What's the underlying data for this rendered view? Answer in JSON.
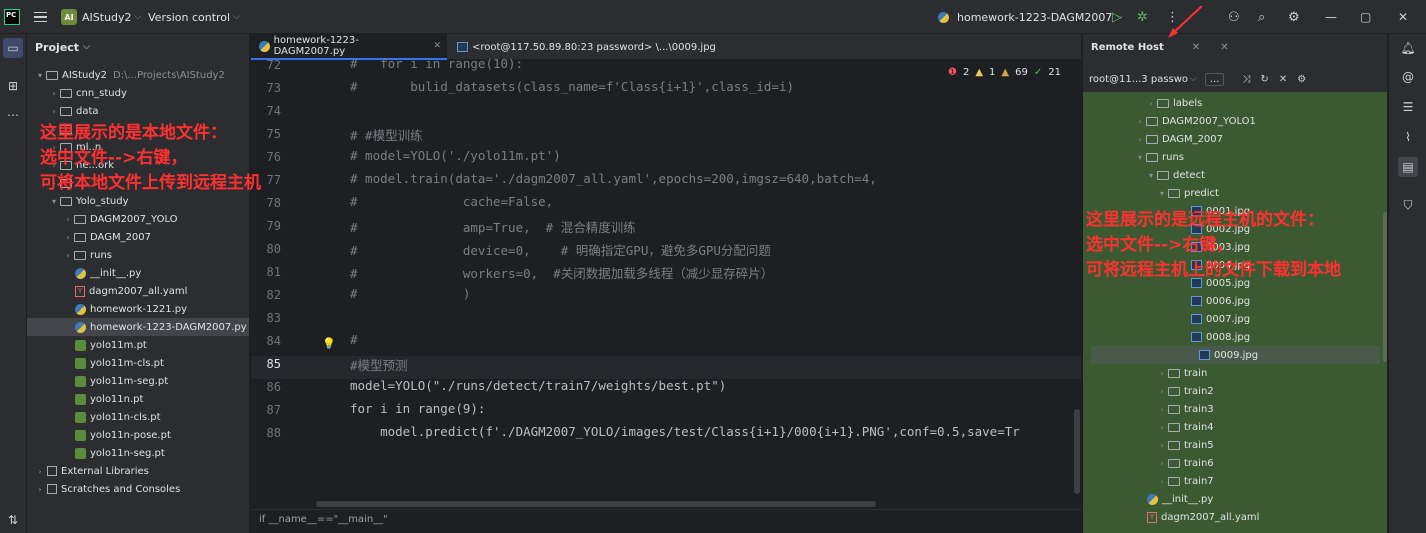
{
  "titlebar": {
    "app_logo": "PC",
    "project_badge": "AI",
    "project_name": "AIStudy2",
    "version_control": "Version control",
    "run_config": "homework-1223-DAGM2007"
  },
  "project_panel": {
    "title": "Project",
    "rows": [
      {
        "indent": 0,
        "arrow": "▾",
        "type": "folder",
        "label": "AIStudy2",
        "suffix": "D:\\...Projects\\AIStudy2"
      },
      {
        "indent": 1,
        "arrow": "›",
        "type": "folder",
        "label": "cnn_study"
      },
      {
        "indent": 1,
        "arrow": "›",
        "type": "folder",
        "label": "data"
      },
      {
        "indent": 1,
        "arrow": "›",
        "type": "folder",
        "label": ""
      },
      {
        "indent": 1,
        "arrow": "›",
        "type": "folder",
        "label": "ml..n"
      },
      {
        "indent": 1,
        "arrow": "›",
        "type": "folder",
        "label": "ne...ork"
      },
      {
        "indent": 1,
        "arrow": "›",
        "type": "folder",
        "label": ""
      },
      {
        "indent": 1,
        "arrow": "▾",
        "type": "folder",
        "label": "Yolo_study"
      },
      {
        "indent": 2,
        "arrow": "›",
        "type": "folder",
        "label": "DAGM2007_YOLO"
      },
      {
        "indent": 2,
        "arrow": "›",
        "type": "folder",
        "label": "DAGM_2007"
      },
      {
        "indent": 2,
        "arrow": "›",
        "type": "folder",
        "label": "runs"
      },
      {
        "indent": 2,
        "arrow": "",
        "type": "py",
        "label": "__init__.py"
      },
      {
        "indent": 2,
        "arrow": "",
        "type": "yaml",
        "label": "dagm2007_all.yaml"
      },
      {
        "indent": 2,
        "arrow": "",
        "type": "py",
        "label": "homework-1221.py"
      },
      {
        "indent": 2,
        "arrow": "",
        "type": "py",
        "label": "homework-1223-DAGM2007.py",
        "selected": true
      },
      {
        "indent": 2,
        "arrow": "",
        "type": "pt",
        "label": "yolo11m.pt"
      },
      {
        "indent": 2,
        "arrow": "",
        "type": "pt",
        "label": "yolo11m-cls.pt"
      },
      {
        "indent": 2,
        "arrow": "",
        "type": "pt",
        "label": "yolo11m-seg.pt"
      },
      {
        "indent": 2,
        "arrow": "",
        "type": "pt",
        "label": "yolo11n.pt"
      },
      {
        "indent": 2,
        "arrow": "",
        "type": "pt",
        "label": "yolo11n-cls.pt"
      },
      {
        "indent": 2,
        "arrow": "",
        "type": "pt",
        "label": "yolo11n-pose.pt"
      },
      {
        "indent": 2,
        "arrow": "",
        "type": "pt",
        "label": "yolo11n-seg.pt"
      },
      {
        "indent": 0,
        "arrow": "›",
        "type": "lib",
        "label": "External Libraries"
      },
      {
        "indent": 0,
        "arrow": "›",
        "type": "lib",
        "label": "Scratches and Consoles"
      }
    ]
  },
  "editor": {
    "tabs": [
      {
        "label": "homework-1223-DAGM2007.py",
        "active": true
      },
      {
        "label": "<root@117.50.89.80:23 password> \\...\\0009.jpg",
        "active": false
      }
    ],
    "inspections": {
      "errors": "2",
      "warnings": "1",
      "weak": "69",
      "ok": "21"
    },
    "line_numbers": [
      "72",
      "73",
      "74",
      "75",
      "76",
      "77",
      "78",
      "79",
      "80",
      "81",
      "82",
      "83",
      "84",
      "85",
      "86",
      "87",
      "88"
    ],
    "current_line": "85",
    "lines": [
      "#   for i in range(10):",
      "#       bulid_datasets(class_name=f'Class{i+1}',class_id=i)",
      "",
      "# #模型训练",
      "# model=YOLO('./yolo11m.pt')",
      "# model.train(data='./dagm2007_all.yaml',epochs=200,imgsz=640,batch=4,",
      "#              cache=False,",
      "#              amp=True,  # 混合精度训练",
      "#              device=0,    # 明确指定GPU，避免多GPU分配问题",
      "#              workers=0,  #关闭数据加载多线程（减少显存碎片）",
      "#              )",
      "",
      "#",
      "#模型预测",
      "model=YOLO(\"./runs/detect/train7/weights/best.pt\")",
      "for i in range(9):",
      "    model.predict(f'./DAGM2007_YOLO/images/test/Class{i+1}/000{i+1}.PNG',conf=0.5,save=Tr"
    ],
    "breadcrumb": "if __name__==\"__main__\""
  },
  "remote_panel": {
    "title": "Remote Host",
    "host": "root@11...3 passwo",
    "more": "...",
    "rows": [
      {
        "indent": 5,
        "arrow": "›",
        "type": "folder",
        "label": "labels"
      },
      {
        "indent": 4,
        "arrow": "›",
        "type": "folder",
        "label": "DAGM2007_YOLO1"
      },
      {
        "indent": 4,
        "arrow": "›",
        "type": "folder",
        "label": "DAGM_2007"
      },
      {
        "indent": 4,
        "arrow": "▾",
        "type": "folder",
        "label": "runs"
      },
      {
        "indent": 5,
        "arrow": "▾",
        "type": "folder",
        "label": "detect"
      },
      {
        "indent": 6,
        "arrow": "▾",
        "type": "folder",
        "label": "predict"
      },
      {
        "indent": 8,
        "arrow": "",
        "type": "img",
        "label": "0001.jpg"
      },
      {
        "indent": 8,
        "arrow": "",
        "type": "img",
        "label": "0002.jpg"
      },
      {
        "indent": 8,
        "arrow": "",
        "type": "img",
        "label": "0003.jpg"
      },
      {
        "indent": 8,
        "arrow": "",
        "type": "img",
        "label": "0004.jpg"
      },
      {
        "indent": 8,
        "arrow": "",
        "type": "img",
        "label": "0005.jpg"
      },
      {
        "indent": 8,
        "arrow": "",
        "type": "img",
        "label": "0006.jpg"
      },
      {
        "indent": 8,
        "arrow": "",
        "type": "img",
        "label": "0007.jpg"
      },
      {
        "indent": 8,
        "arrow": "",
        "type": "img",
        "label": "0008.jpg"
      },
      {
        "indent": 8,
        "arrow": "",
        "type": "img",
        "label": "0009.jpg",
        "selected": true
      },
      {
        "indent": 6,
        "arrow": "›",
        "type": "folder",
        "label": "train"
      },
      {
        "indent": 6,
        "arrow": "›",
        "type": "folder",
        "label": "train2"
      },
      {
        "indent": 6,
        "arrow": "›",
        "type": "folder",
        "label": "train3"
      },
      {
        "indent": 6,
        "arrow": "›",
        "type": "folder",
        "label": "train4"
      },
      {
        "indent": 6,
        "arrow": "›",
        "type": "folder",
        "label": "train5"
      },
      {
        "indent": 6,
        "arrow": "›",
        "type": "folder",
        "label": "train6"
      },
      {
        "indent": 6,
        "arrow": "›",
        "type": "folder",
        "label": "train7"
      },
      {
        "indent": 4,
        "arrow": "",
        "type": "py",
        "label": "__init__.py"
      },
      {
        "indent": 4,
        "arrow": "",
        "type": "yaml",
        "label": "dagm2007_all.yaml"
      }
    ]
  },
  "annotations": {
    "local": [
      "这里展示的是本地文件：",
      "选中文件-->右键，",
      "可将本地文件上传到远程主机"
    ],
    "remote": [
      "这里展示的是远程主机的文件：",
      "选中文件-->右键，",
      "可将远程主机上的文件下载到本地"
    ]
  },
  "colors": {
    "accent": "#3574f0",
    "annotation": "#ff3030",
    "remote_bg": "#3c5a32"
  }
}
